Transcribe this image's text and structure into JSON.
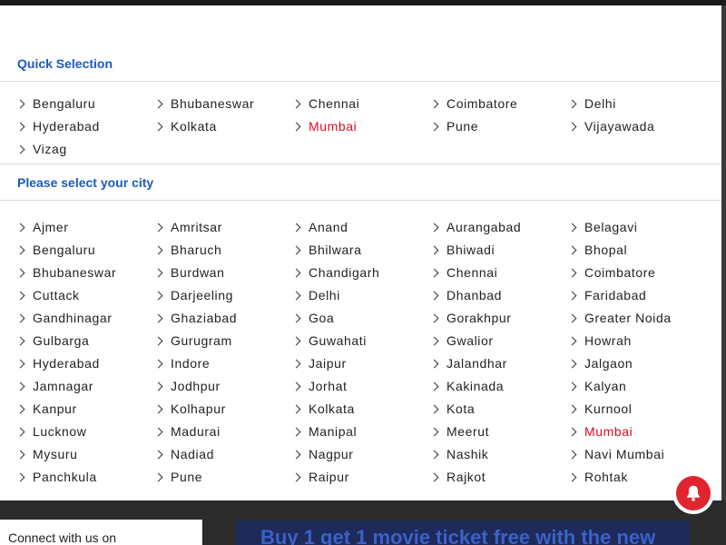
{
  "quick": {
    "title": "Quick Selection",
    "cities": [
      "Bengaluru",
      "Bhubaneswar",
      "Chennai",
      "Coimbatore",
      "Delhi",
      "Hyderabad",
      "Kolkata",
      "Mumbai",
      "Pune",
      "Vijayawada",
      "Vizag"
    ],
    "selected": "Mumbai"
  },
  "all": {
    "title": "Please select your city",
    "cities": [
      "Ajmer",
      "Amritsar",
      "Anand",
      "Aurangabad",
      "Belagavi",
      "Bengaluru",
      "Bharuch",
      "Bhilwara",
      "Bhiwadi",
      "Bhopal",
      "Bhubaneswar",
      "Burdwan",
      "Chandigarh",
      "Chennai",
      "Coimbatore",
      "Cuttack",
      "Darjeeling",
      "Delhi",
      "Dhanbad",
      "Faridabad",
      "Gandhinagar",
      "Ghaziabad",
      "Goa",
      "Gorakhpur",
      "Greater Noida",
      "Gulbarga",
      "Gurugram",
      "Guwahati",
      "Gwalior",
      "Howrah",
      "Hyderabad",
      "Indore",
      "Jaipur",
      "Jalandhar",
      "Jalgaon",
      "Jamnagar",
      "Jodhpur",
      "Jorhat",
      "Kakinada",
      "Kalyan",
      "Kanpur",
      "Kolhapur",
      "Kolkata",
      "Kota",
      "Kurnool",
      "Lucknow",
      "Madurai",
      "Manipal",
      "Meerut",
      "Mumbai",
      "Mysuru",
      "Nadiad",
      "Nagpur",
      "Nashik",
      "Navi Mumbai",
      "Panchkula",
      "Pune",
      "Raipur",
      "Rajkot",
      "Rohtak"
    ],
    "selected": "Mumbai"
  },
  "footer": {
    "connect_text": "Connect with us on",
    "promo_text": "Buy 1 get 1 movie ticket free with the new"
  },
  "colors": {
    "accent": "#1a5bbf",
    "selected": "#e00b1e",
    "notification": "#e1252f"
  },
  "icons": {
    "city_arrow": "chevron-right-icon",
    "notification": "bell-icon"
  }
}
